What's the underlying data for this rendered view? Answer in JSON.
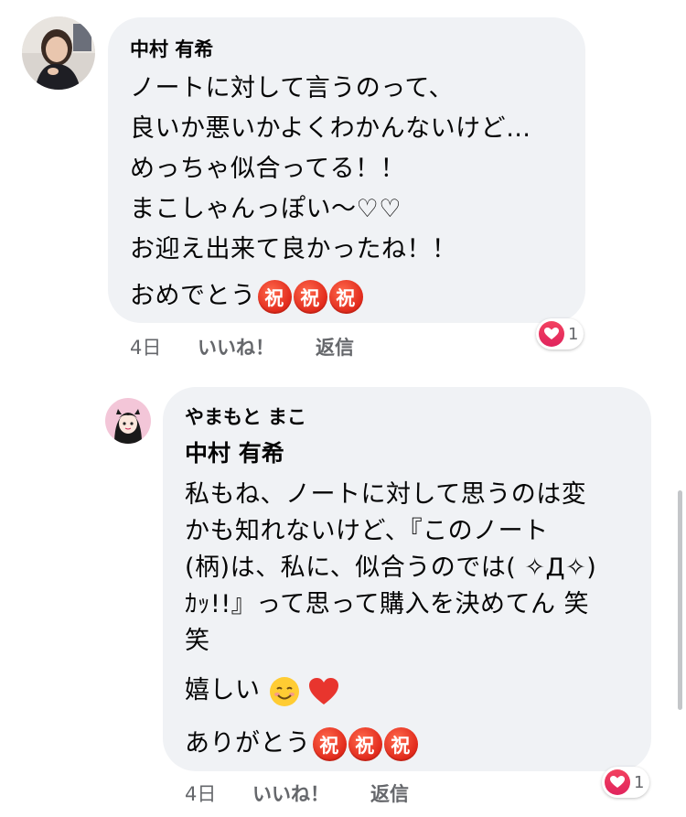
{
  "comments": [
    {
      "author": "中村 有希",
      "lines": [
        "ノートに対して言うのって、",
        "良いか悪いかよくわかんないけど…",
        "めっちゃ似合ってる！！",
        "まこしゃんっぽい〜♡♡",
        "お迎え出来て良かったね！！"
      ],
      "final_text": "おめでとう",
      "final_emoji": [
        "祝",
        "祝",
        "祝"
      ],
      "time": "4日",
      "like_label": "いいね！",
      "reply_label": "返信",
      "reaction_count": "1"
    },
    {
      "author": "やまもと まこ",
      "mention": "中村 有希",
      "lines": [
        "私もね、ノートに対して思うのは変",
        "かも知れないけど、『このノート",
        "(柄)は、私に、似合うのでは( ✧Д✧)",
        "ｶｯ!!』って思って購入を決めてん 笑",
        "笑"
      ],
      "joy_text": "嬉しい",
      "final_text": "ありがとう",
      "final_emoji": [
        "祝",
        "祝",
        "祝"
      ],
      "time": "4日",
      "like_label": "いいね！",
      "reply_label": "返信",
      "reaction_count": "1"
    }
  ]
}
